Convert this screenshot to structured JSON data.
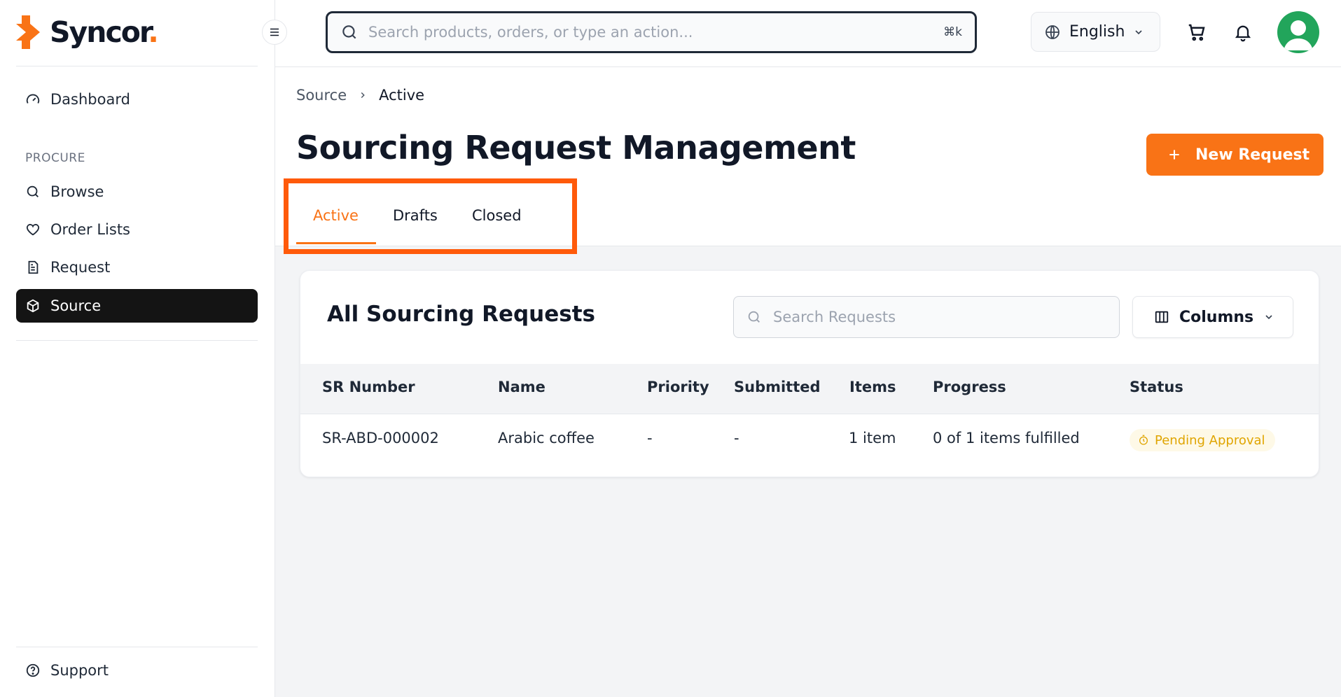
{
  "brand": {
    "name": "Syncor",
    "dot": ".",
    "accent": "#f97316"
  },
  "sidebar": {
    "items": [
      {
        "label": "Dashboard",
        "icon": "gauge-icon"
      },
      {
        "label": "Browse",
        "icon": "search-icon"
      },
      {
        "label": "Order Lists",
        "icon": "heart-icon"
      },
      {
        "label": "Request",
        "icon": "document-icon"
      },
      {
        "label": "Source",
        "icon": "cube-icon",
        "active": true
      }
    ],
    "section_label": "PROCURE",
    "support_label": "Support"
  },
  "topbar": {
    "search_placeholder": "Search products, orders, or type an action...",
    "search_shortcut": "⌘k",
    "language": "English"
  },
  "breadcrumb": {
    "parent": "Source",
    "current": "Active"
  },
  "page": {
    "title": "Sourcing Request Management",
    "new_button": "New Request"
  },
  "tabs": [
    {
      "label": "Active",
      "active": true
    },
    {
      "label": "Drafts"
    },
    {
      "label": "Closed"
    }
  ],
  "table_card": {
    "title": "All Sourcing Requests",
    "search_placeholder": "Search Requests",
    "columns_button": "Columns",
    "headers": [
      "SR Number",
      "Name",
      "Priority",
      "Submitted",
      "Items",
      "Progress",
      "Status"
    ],
    "rows": [
      {
        "sr_number": "SR-ABD-000002",
        "name": "Arabic coffee",
        "priority": "-",
        "submitted": "-",
        "items": "1 item",
        "progress": "0 of 1 items fulfilled",
        "status": "Pending Approval"
      }
    ]
  }
}
